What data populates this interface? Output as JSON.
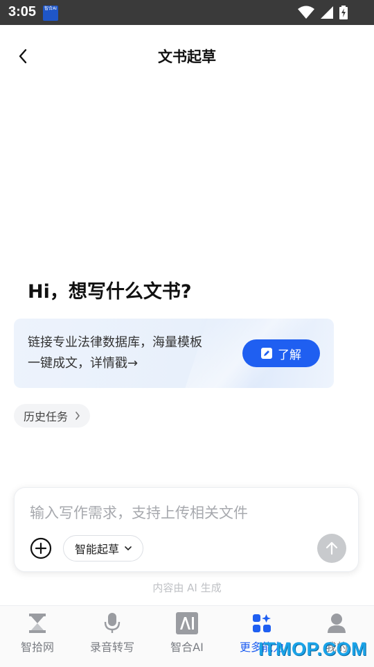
{
  "status_bar": {
    "time": "3:05",
    "notification_app_label": "智合AI"
  },
  "header": {
    "title": "文书起草"
  },
  "greeting": "Hi，想写什么文书?",
  "promo": {
    "line1": "链接专业法律数据库，海量模板",
    "line2": "一键成文，详情戳→",
    "button_label": "了解"
  },
  "history": {
    "label": "历史任务"
  },
  "composer": {
    "placeholder": "输入写作需求，支持上传相关文件",
    "value": "",
    "mode_label": "智能起草"
  },
  "disclaimer": "内容由 AI 生成",
  "tabs": [
    {
      "label": "智拾网",
      "icon": "hourglass-icon",
      "active": false
    },
    {
      "label": "录音转写",
      "icon": "microphone-icon",
      "active": false
    },
    {
      "label": "智合AI",
      "icon": "ai-logo-icon",
      "active": false
    },
    {
      "label": "更多能力",
      "icon": "apps-grid-icon",
      "active": true
    },
    {
      "label": "我的",
      "icon": "person-icon",
      "active": false
    }
  ],
  "watermark": "ITMOP.COM",
  "colors": {
    "accent": "#1f5ff1",
    "status_bar": "#3a3a3a",
    "promo_bg": "#e8f0fb",
    "send_disabled": "#c8cacd"
  }
}
